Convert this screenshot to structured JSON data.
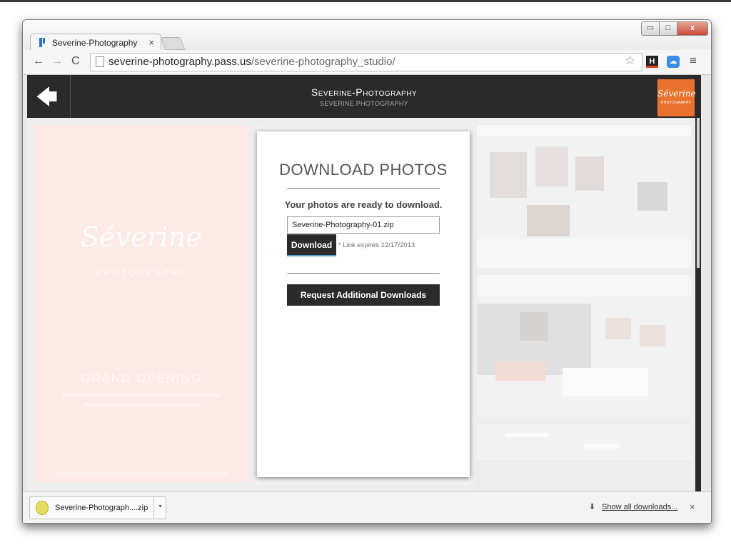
{
  "browser": {
    "tab_title": "Severine-Photography",
    "tab_close": "×",
    "url_host": "severine-photography.pass.us",
    "url_path": "/severine-photography_studio/",
    "window_controls": {
      "minimize": "▭",
      "maximize": "□",
      "close": "x"
    },
    "nav": {
      "back": "←",
      "forward": "→",
      "reload": "C"
    },
    "star": "☆",
    "ext_h": "H",
    "menu": "≡"
  },
  "site": {
    "title": "Severine-Photography",
    "subtitle": "SEVERINE PHOTOGRAPHY",
    "back_arrow": "🡄",
    "logo_script": "Séverine",
    "logo_small": "PHOTOGRAPHY"
  },
  "promo": {
    "script": "Séverine",
    "tag": "PHOTOGRAPHY",
    "event": "GRAND OPENING"
  },
  "download": {
    "title": "DOWNLOAD PHOTOS",
    "ready_text": "Your photos are ready to download.",
    "file_name": "Severine-Photography-01.zip",
    "download_label": "Download",
    "expires": "* Link expires 12/17/2013",
    "request_label": "Request Additional Downloads"
  },
  "download_bar": {
    "file_label": "Severine-Photograph....zip",
    "dropdown": "▾",
    "show_all": "Show all downloads...",
    "show_all_icon": "⬇",
    "close": "×"
  },
  "colors": {
    "header_bg": "#2a2a2a",
    "logo_orange": "#e8722e",
    "promo_pink": "#fde9e6",
    "button_dark": "#2b2b2b",
    "close_red": "#c74a36"
  }
}
